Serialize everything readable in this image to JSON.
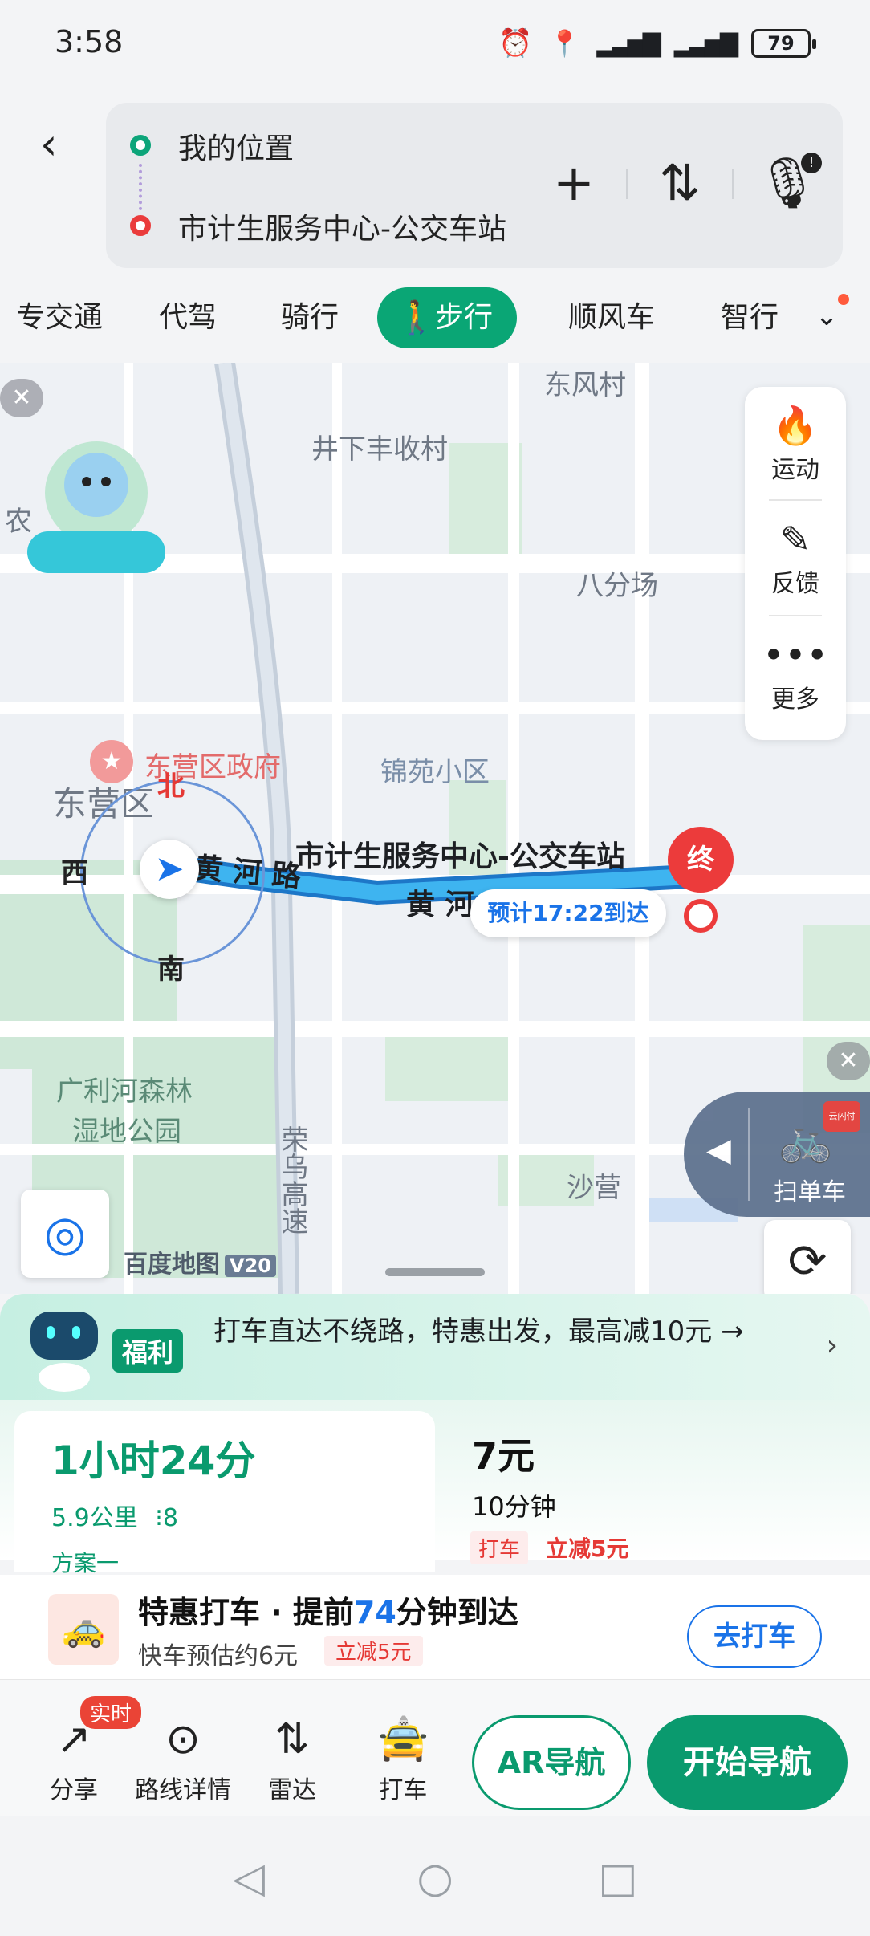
{
  "status_bar": {
    "time": "3:58",
    "battery": "79"
  },
  "route": {
    "from": "我的位置",
    "to": "市计生服务中心-公交车站"
  },
  "modes": [
    {
      "label": "专交通"
    },
    {
      "label": "代驾"
    },
    {
      "label": "骑行"
    },
    {
      "label": "步行",
      "active": true
    },
    {
      "label": "顺风车"
    },
    {
      "label": "智行"
    }
  ],
  "map": {
    "labels": {
      "dongfengcun": "东风村",
      "jingxia": "井下丰收村",
      "nong": "农",
      "bafenchang": "八分场",
      "gov": "东营区政府",
      "jinyuan": "锦苑小区",
      "dongying": "东营区",
      "road_huanghe1": "黄 河 路",
      "road_huanghe2": "黄 河 路",
      "destination": "市计生服务中心-公交车站",
      "guangli": "广利河森林",
      "guangli2": "湿地公园",
      "expressway": "荣乌高速",
      "shaying": "沙营"
    },
    "eta": "预计17:22到达",
    "end_marker": "终",
    "compass": {
      "n": "北",
      "w": "西",
      "s": "南"
    },
    "side_menu": [
      {
        "label": "运动",
        "icon": "flame-icon"
      },
      {
        "label": "反馈",
        "icon": "pencil-icon"
      },
      {
        "label": "更多",
        "icon": "more-icon"
      }
    ],
    "bike_label": "扫单车",
    "pay_badge": "云闪付",
    "logo": "百度地图",
    "logo_version": "V20"
  },
  "promo": {
    "badge": "福利",
    "text": "打车直达不绕路，特惠出发，最高减10元 →"
  },
  "plan": {
    "time": "1小时24分",
    "distance": "5.9公里",
    "lights": "8",
    "name": "方案一"
  },
  "alt": {
    "price": "7元",
    "time": "10分钟",
    "tag": "打车",
    "discount": "立减5元"
  },
  "taxi": {
    "title_pre": "特惠打车 · 提前",
    "title_num": "74",
    "title_post": "分钟到达",
    "sub": "快车预估约6元",
    "discount": "立减5元",
    "button": "去打车"
  },
  "actions": [
    {
      "label": "分享",
      "icon": "share-icon"
    },
    {
      "label": "路线详情",
      "icon": "location-pin-icon"
    },
    {
      "label": "雷达",
      "icon": "radar-icon"
    },
    {
      "label": "打车",
      "icon": "taxi-icon"
    }
  ],
  "realtime_badge": "实时",
  "ar_button": "AR导航",
  "start_button": "开始导航"
}
